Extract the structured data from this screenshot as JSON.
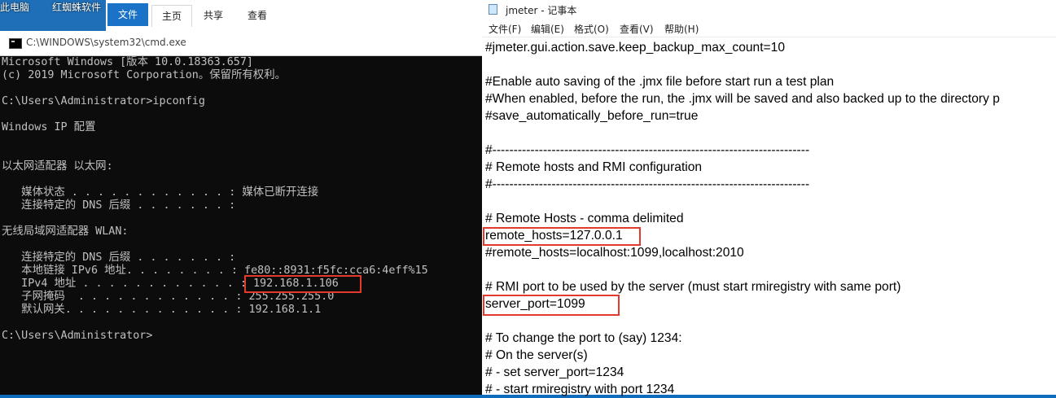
{
  "desktop": {
    "this_pc": "此电脑",
    "app": "红蜘蛛软件"
  },
  "explorer": {
    "tabs": [
      "文件",
      "主页",
      "共享",
      "查看"
    ]
  },
  "cmd": {
    "title": "C:\\WINDOWS\\system32\\cmd.exe",
    "lines": [
      "Microsoft Windows [版本 10.0.18363.657]",
      "(c) 2019 Microsoft Corporation。保留所有权利。",
      "C:\\Users\\Administrator>ipconfig",
      "Windows IP 配置",
      "以太网适配器 以太网:",
      "   媒体状态 . . . . . . . . . . . . : 媒体已断开连接",
      "   连接特定的 DNS 后缀 . . . . . . . :",
      "无线局域网适配器 WLAN:",
      "   连接特定的 DNS 后缀 . . . . . . . :",
      "   本地链接 IPv6 地址. . . . . . . . : fe80::8931:f5fc:cca6:4eff%15",
      "   IPv4 地址 . . . . . . . . . . . . : 192.168.1.106",
      "   子网掩码  . . . . . . . . . . . . : 255.255.255.0",
      "   默认网关. . . . . . . . . . . . . : 192.168.1.1",
      "C:\\Users\\Administrator>"
    ]
  },
  "notepad": {
    "title": "jmeter - 记事本",
    "menu": [
      "文件(F)",
      "编辑(E)",
      "格式(O)",
      "查看(V)",
      "帮助(H)"
    ],
    "lines": [
      "#jmeter.gui.action.save.keep_backup_max_count=10",
      "#Enable auto saving of the .jmx file before start run a test plan",
      "#When enabled, before the run, the .jmx will be saved and also backed up to the directory p",
      "#save_automatically_before_run=true",
      "#---------------------------------------------------------------------------",
      "# Remote hosts and RMI configuration",
      "#---------------------------------------------------------------------------",
      "# Remote Hosts - comma delimited",
      "remote_hosts=127.0.0.1",
      "#remote_hosts=localhost:1099,localhost:2010",
      "# RMI port to be used by the server (must start rmiregistry with same port)",
      "server_port=1099",
      "# To change the port to (say) 1234:",
      "# On the server(s)",
      "# - set server_port=1234",
      "# - start rmiregistry with port 1234"
    ]
  },
  "colors": {
    "highlight": "#e5392d",
    "console_bg": "#0c0c0c",
    "console_text": "#c0c0c0"
  }
}
